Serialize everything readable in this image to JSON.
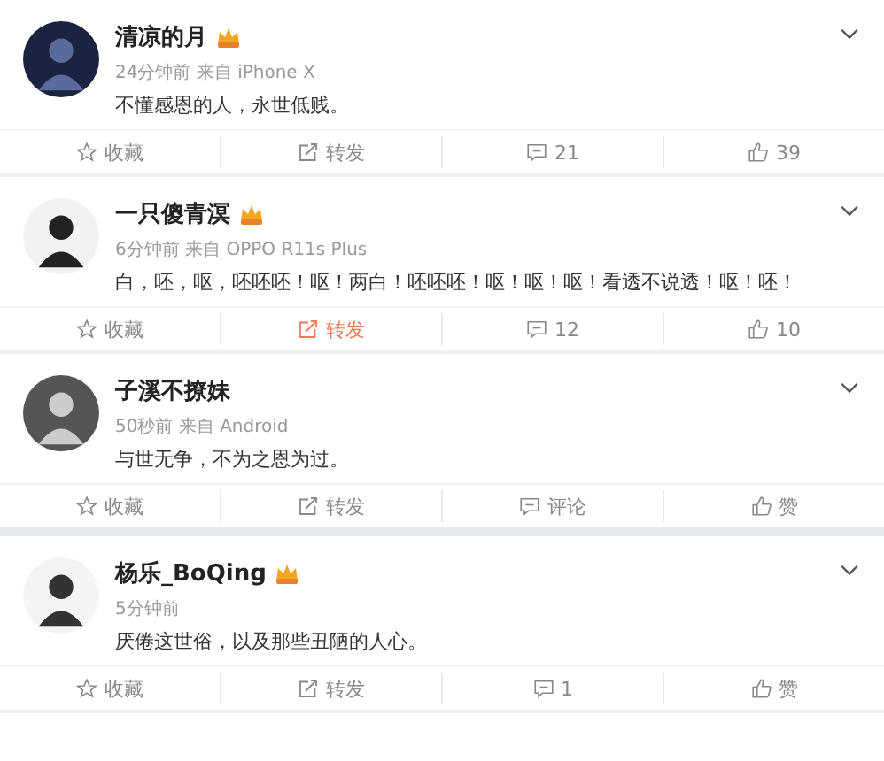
{
  "posts": [
    {
      "name": "清凉的月",
      "vip": true,
      "meta": "24分钟前 来自 iPhone X",
      "text": "不懂感恩的人，永世低贱。",
      "actions": [
        {
          "kind": "favorite",
          "label": "收藏",
          "selected": false
        },
        {
          "kind": "repost",
          "label": "转发",
          "selected": false
        },
        {
          "kind": "comment",
          "label": "21",
          "selected": false
        },
        {
          "kind": "like",
          "label": "39",
          "selected": false
        }
      ]
    },
    {
      "name": "一只傻青溟",
      "vip": true,
      "meta": "6分钟前 来自 OPPO R11s Plus",
      "text": "白，呸，呕，呸呸呸！呕！两白！呸呸呸！呕！呕！呕！看透不说透！呕！呸！",
      "actions": [
        {
          "kind": "favorite",
          "label": "收藏",
          "selected": false
        },
        {
          "kind": "repost",
          "label": "转发",
          "selected": true
        },
        {
          "kind": "comment",
          "label": "12",
          "selected": false
        },
        {
          "kind": "like",
          "label": "10",
          "selected": false
        }
      ]
    },
    {
      "name": "子溪不撩妹",
      "vip": false,
      "meta": "50秒前 来自 Android",
      "text": "与世无争，不为之恩为过。",
      "actions": [
        {
          "kind": "favorite",
          "label": "收藏",
          "selected": false
        },
        {
          "kind": "repost",
          "label": "转发",
          "selected": false
        },
        {
          "kind": "comment",
          "label": "评论",
          "selected": false
        },
        {
          "kind": "like",
          "label": "赞",
          "selected": false
        }
      ]
    },
    {
      "name": "杨乐_BoQing",
      "vip": true,
      "meta": "5分钟前",
      "text": "厌倦这世俗，以及那些丑陋的人心。",
      "actions": [
        {
          "kind": "favorite",
          "label": "收藏",
          "selected": false
        },
        {
          "kind": "repost",
          "label": "转发",
          "selected": false
        },
        {
          "kind": "comment",
          "label": "1",
          "selected": false
        },
        {
          "kind": "like",
          "label": "赞",
          "selected": false
        }
      ]
    }
  ]
}
